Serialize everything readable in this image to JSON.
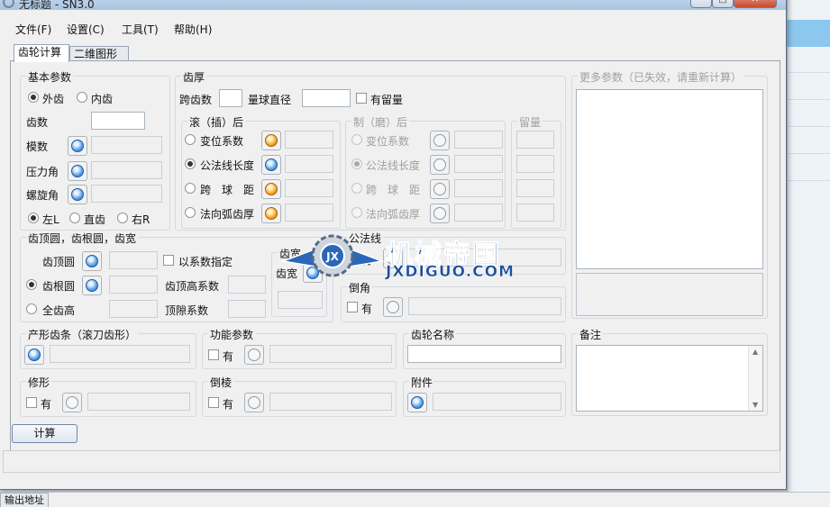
{
  "window": {
    "title": "无标题 - SN3.0"
  },
  "menu": [
    "文件(F)",
    "设置(C)",
    "工具(T)",
    "帮助(H)"
  ],
  "tabs": [
    "齿轮计算",
    "二维图形"
  ],
  "basic": {
    "title": "基本参数",
    "external": "外齿",
    "internal": "内齿",
    "teeth": "齿数",
    "module": "模数",
    "pressure_angle": "压力角",
    "helix_angle": "螺旋角",
    "left": "左L",
    "spur": "直齿",
    "right": "右R"
  },
  "thickness": {
    "title": "齿厚",
    "span_teeth": "跨齿数",
    "ball_dia": "量球直径",
    "has_allowance": "有留量",
    "hob_group": "滚（插）后",
    "grind_group": "制（磨）后",
    "allowance_group": "留量",
    "items": [
      "变位系数",
      "公法线长度",
      "跨　球　距",
      "法向弧齿厚"
    ]
  },
  "more": {
    "title": "更多参数（已失效，请重新计算）"
  },
  "tip": {
    "title": "齿顶圆，齿根圆，齿宽",
    "tip_circle": "齿顶圆",
    "by_coeff": "以系数指定",
    "root_circle": "齿根圆",
    "addendum_coeff": "齿顶高系数",
    "whole_depth": "全齿高",
    "clearance_coeff": "顶隙系数",
    "width_group": "齿宽",
    "face_width": "齿宽"
  },
  "span_line": {
    "title": "公法线",
    "has": "有"
  },
  "chamfer": {
    "title": "倒角",
    "has": "有"
  },
  "rack": {
    "title": "产形齿条（滚刀齿形）"
  },
  "function_params": {
    "title": "功能参数",
    "has": "有"
  },
  "gear_name": {
    "title": "齿轮名称"
  },
  "notes": {
    "title": "备注"
  },
  "modify": {
    "title": "修形",
    "has": "有"
  },
  "bevel": {
    "title": "倒棱",
    "has": "有"
  },
  "attachment": {
    "title": "附件"
  },
  "calc_button": "计算",
  "taskbar": {
    "item": "输出地址"
  },
  "watermark": {
    "cn": "机械帝国",
    "url": "JXDIGUO.COM",
    "logo": "JX"
  }
}
